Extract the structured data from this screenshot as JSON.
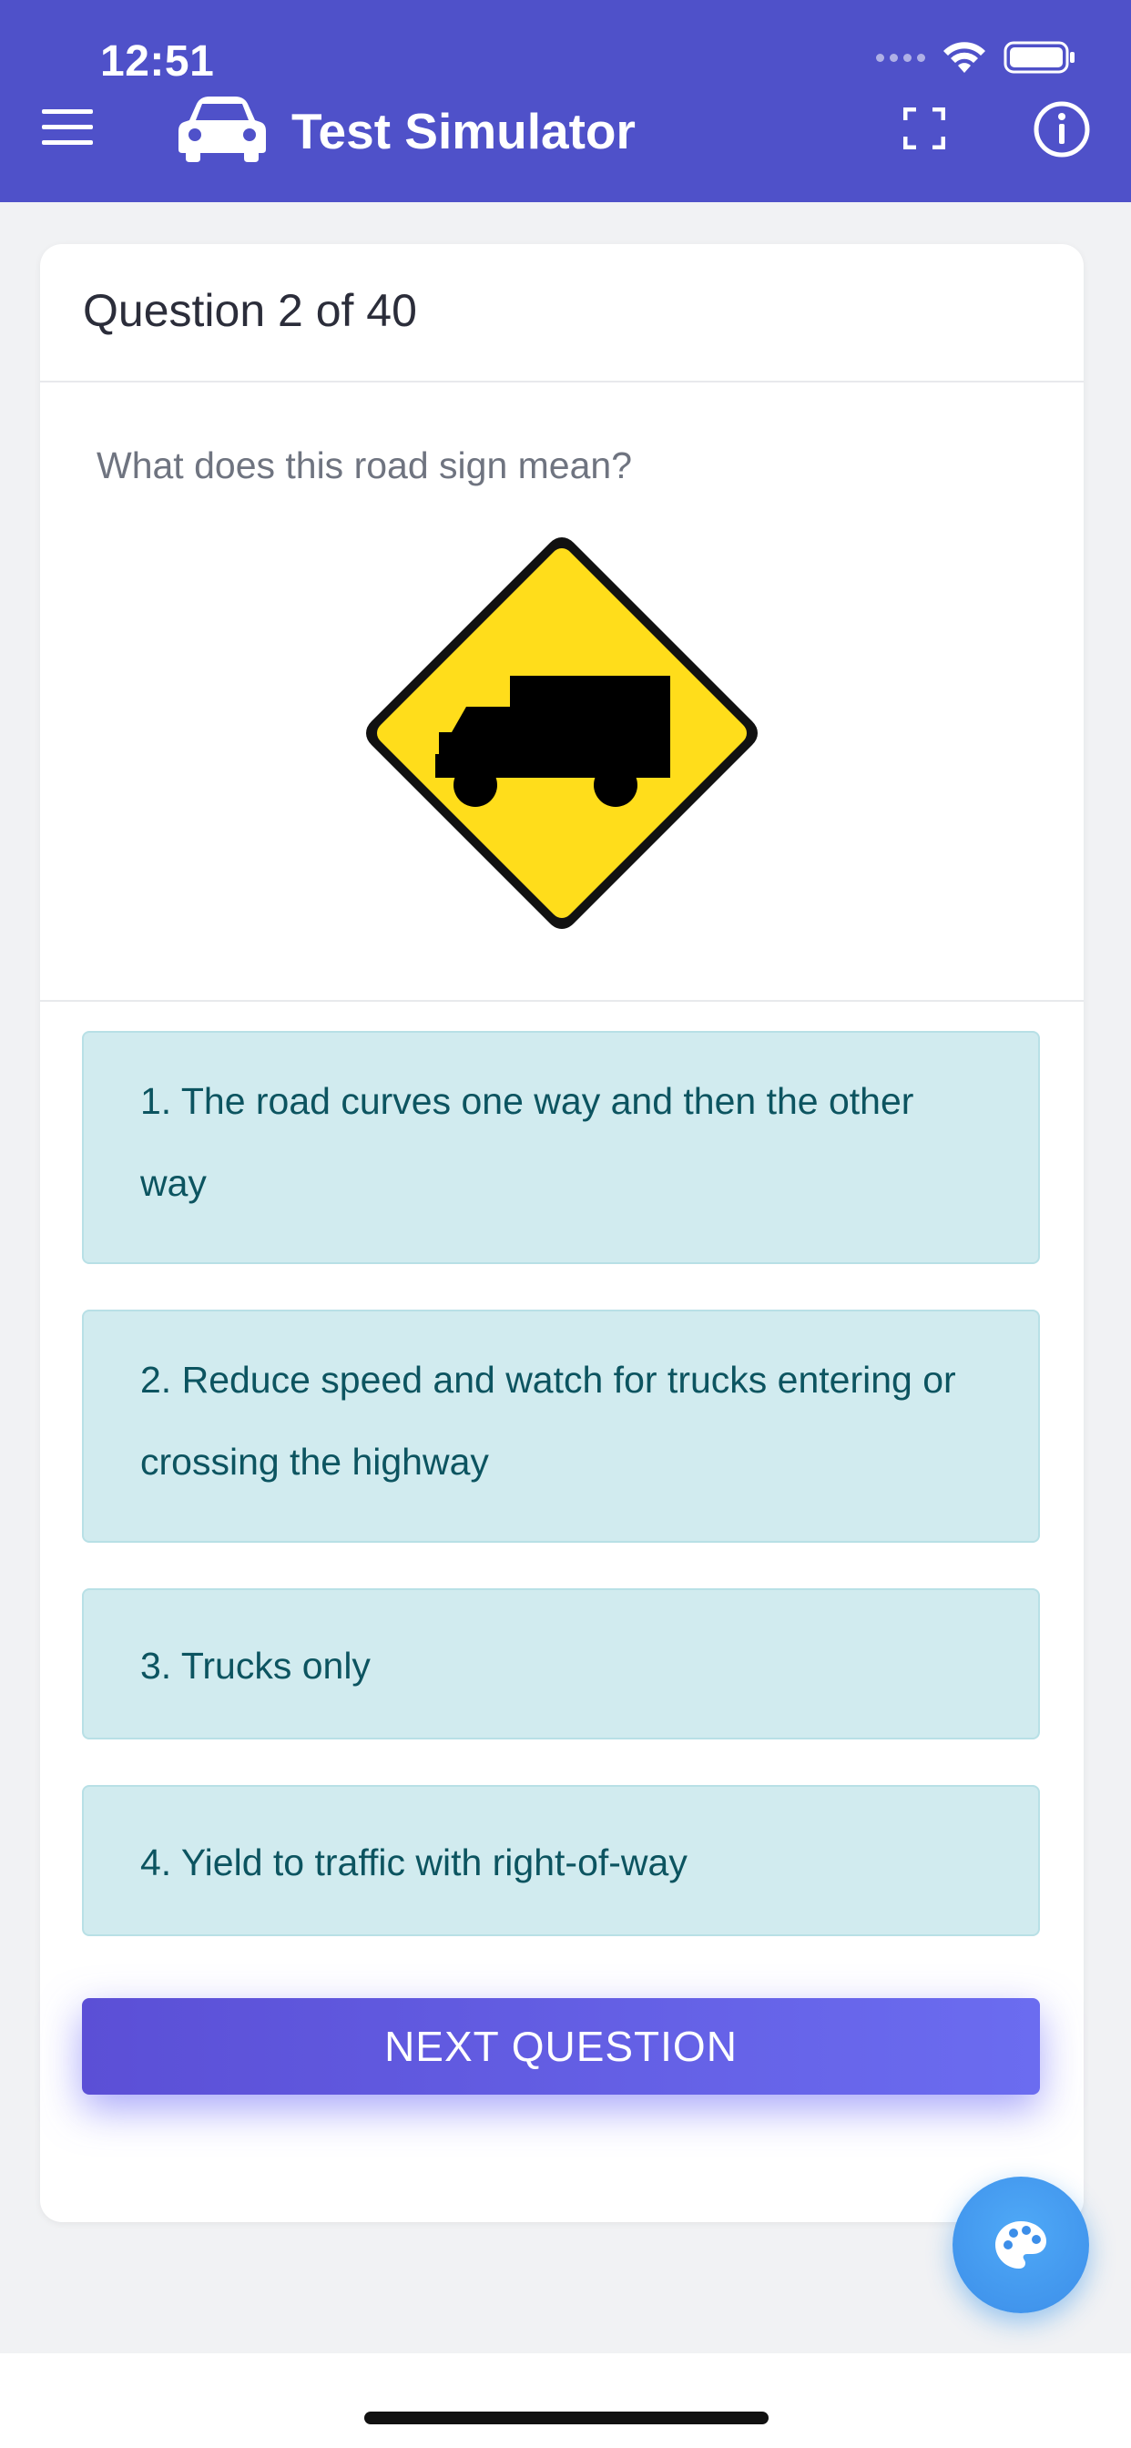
{
  "status_bar": {
    "time": "12:51"
  },
  "header": {
    "title": "Test Simulator",
    "icons": [
      "menu-icon",
      "car-icon",
      "fullscreen-icon",
      "info-icon"
    ]
  },
  "question": {
    "title": "Question 2 of 40",
    "prompt": "What does this road sign mean?",
    "sign_icon": "truck-crossing-sign"
  },
  "answers": [
    {
      "label": "1. The road curves one way and then the other way"
    },
    {
      "label": "2. Reduce speed and watch for trucks entering or crossing the highway"
    },
    {
      "label": "3. Trucks only"
    },
    {
      "label": "4. Yield to traffic with right-of-way"
    }
  ],
  "next_button": {
    "label": "NEXT QUESTION"
  },
  "fab": {
    "icon": "palette-icon"
  },
  "colors": {
    "header": "#4f51c9",
    "answer_bg": "#d1ebef",
    "answer_text": "#0c5460",
    "button": "#5b4fd6",
    "fab": "#3c8ee9",
    "sign_yellow": "#ffdd1b"
  }
}
